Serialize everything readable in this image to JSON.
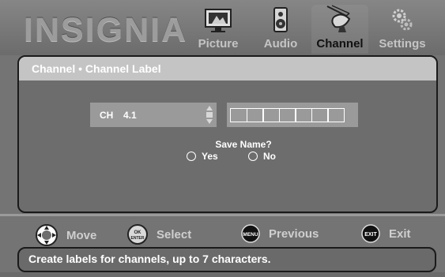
{
  "brand": {
    "logo": "INSIGNIA",
    "tm": "™"
  },
  "menu_tabs": [
    {
      "label": "Picture",
      "icon": "tv-icon",
      "active": false
    },
    {
      "label": "Audio",
      "icon": "speaker-icon",
      "active": false
    },
    {
      "label": "Channel",
      "icon": "satellite-dish-icon",
      "active": true
    },
    {
      "label": "Settings",
      "icon": "gears-icon",
      "active": false
    }
  ],
  "panel": {
    "title": "Channel • Channel Label",
    "channel_label": "CH",
    "channel_value": "4.1",
    "name_cells": 7,
    "save_question": "Save Name?",
    "yes_label": "Yes",
    "no_label": "No"
  },
  "nav": {
    "move": "Move",
    "select": "Select",
    "select_icon_text": "OK ENTER",
    "previous": "Previous",
    "previous_icon_text": "MENU",
    "exit": "Exit",
    "exit_icon_text": "EXIT"
  },
  "help_text": "Create labels for channels, up to 7 characters."
}
